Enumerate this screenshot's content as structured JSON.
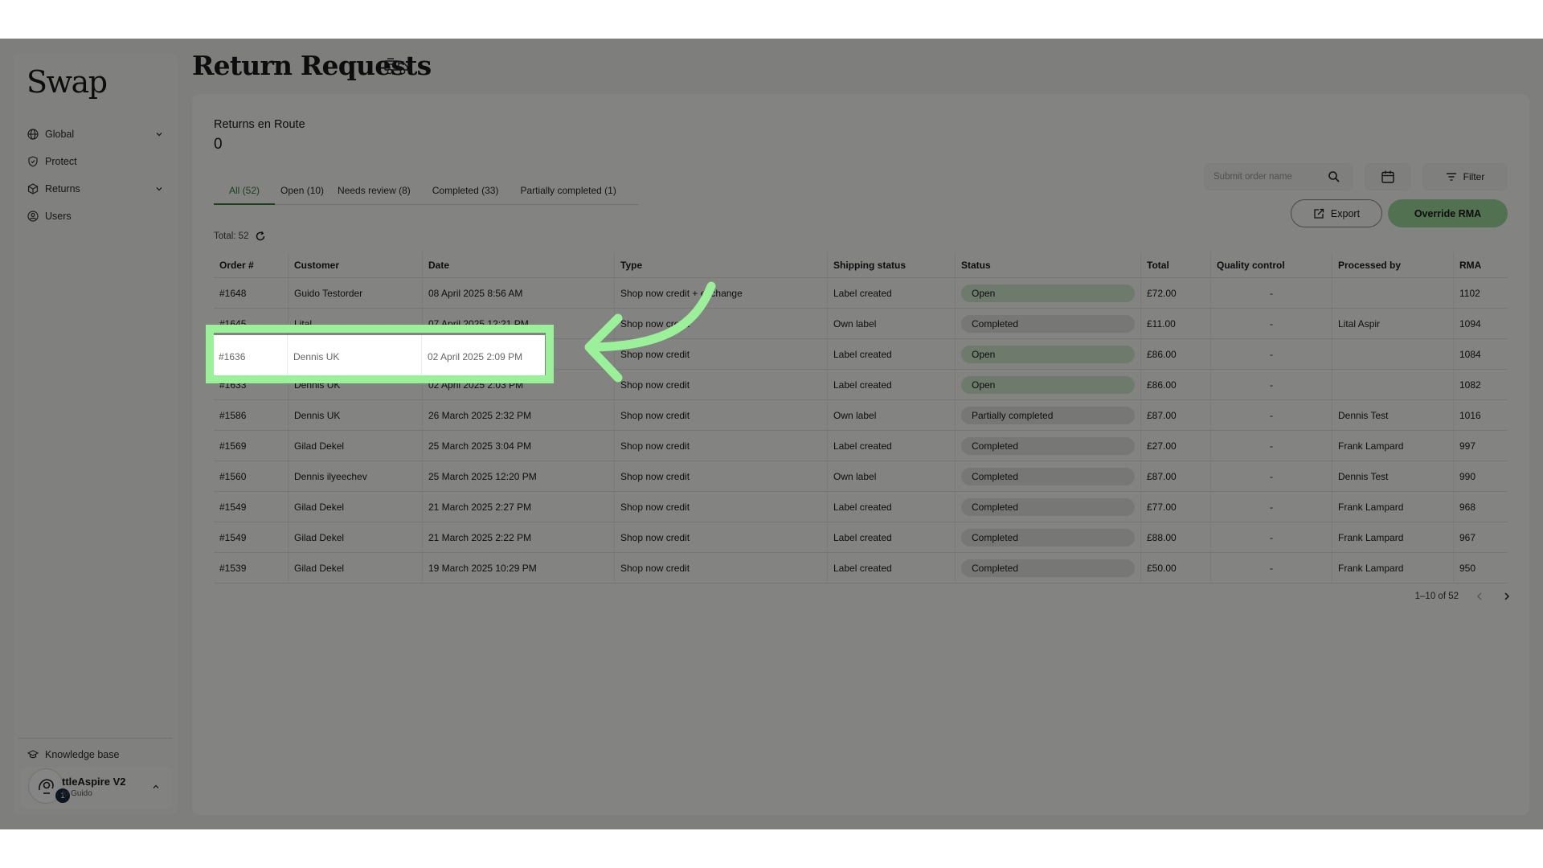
{
  "app": {
    "logo": "Swap",
    "page_title": "Return Requests"
  },
  "sidebar": {
    "items": [
      {
        "label": "Global",
        "icon": "globe-icon",
        "expandable": true
      },
      {
        "label": "Protect",
        "icon": "shield-icon",
        "expandable": false
      },
      {
        "label": "Returns",
        "icon": "package-icon",
        "expandable": true
      },
      {
        "label": "Users",
        "icon": "user-circle-icon",
        "expandable": false
      }
    ],
    "knowledge_base": "Knowledge base",
    "account": {
      "name": "ttleAspire V2",
      "sub": "to Guido",
      "badge": "1"
    }
  },
  "summary": {
    "label": "Returns en Route",
    "count": "0"
  },
  "tabs": [
    {
      "label": "All (52)",
      "active": true
    },
    {
      "label": "Open (10)",
      "active": false
    },
    {
      "label": "Needs review (8)",
      "active": false
    },
    {
      "label": "Completed (33)",
      "active": false
    },
    {
      "label": "Partially completed (1)",
      "active": false
    }
  ],
  "total_label": "Total: 52",
  "toolbar": {
    "search_placeholder": "Submit order name",
    "filter_label": "Filter",
    "export_label": "Export",
    "override_label": "Override RMA"
  },
  "table": {
    "headers": [
      "Order #",
      "Customer",
      "Date",
      "Type",
      "Shipping status",
      "Status",
      "Total",
      "Quality control",
      "Processed by",
      "RMA"
    ],
    "rows": [
      {
        "order": "#1648",
        "customer": "Guido Testorder",
        "date": "08 April 2025 8:56 AM",
        "type": "Shop now credit + exchange",
        "shipping": "Label created",
        "status": "Open",
        "total": "£72.00",
        "qc": "-",
        "processed_by": "",
        "rma": "1102"
      },
      {
        "order": "#1645",
        "customer": "Lital",
        "date": "07 April 2025 12:21 PM",
        "type": "Shop now credit",
        "shipping": "Own label",
        "status": "Completed",
        "total": "£11.00",
        "qc": "-",
        "processed_by": "Lital Aspir",
        "rma": "1094"
      },
      {
        "order": "#1636",
        "customer": "Dennis UK",
        "date": "02 April 2025 2:09 PM",
        "type": "Shop now credit",
        "shipping": "Label created",
        "status": "Open",
        "total": "£86.00",
        "qc": "-",
        "processed_by": "",
        "rma": "1084"
      },
      {
        "order": "#1633",
        "customer": "Dennis UK",
        "date": "02 April 2025 2:03 PM",
        "type": "Shop now credit",
        "shipping": "Label created",
        "status": "Open",
        "total": "£86.00",
        "qc": "-",
        "processed_by": "",
        "rma": "1082"
      },
      {
        "order": "#1586",
        "customer": "Dennis UK",
        "date": "26 March 2025 2:32 PM",
        "type": "Shop now credit",
        "shipping": "Own label",
        "status": "Partially completed",
        "total": "£87.00",
        "qc": "-",
        "processed_by": "Dennis Test",
        "rma": "1016"
      },
      {
        "order": "#1569",
        "customer": "Gilad Dekel",
        "date": "25 March 2025 3:04 PM",
        "type": "Shop now credit",
        "shipping": "Label created",
        "status": "Completed",
        "total": "£27.00",
        "qc": "-",
        "processed_by": "Frank Lampard",
        "rma": "997"
      },
      {
        "order": "#1560",
        "customer": "Dennis ilyeechev",
        "date": "25 March 2025 12:20 PM",
        "type": "Shop now credit",
        "shipping": "Own label",
        "status": "Completed",
        "total": "£87.00",
        "qc": "-",
        "processed_by": "Dennis Test",
        "rma": "990"
      },
      {
        "order": "#1549",
        "customer": "Gilad Dekel",
        "date": "21 March 2025 2:27 PM",
        "type": "Shop now credit",
        "shipping": "Label created",
        "status": "Completed",
        "total": "£77.00",
        "qc": "-",
        "processed_by": "Frank Lampard",
        "rma": "968"
      },
      {
        "order": "#1549",
        "customer": "Gilad Dekel",
        "date": "21 March 2025 2:22 PM",
        "type": "Shop now credit",
        "shipping": "Label created",
        "status": "Completed",
        "total": "£88.00",
        "qc": "-",
        "processed_by": "Frank Lampard",
        "rma": "967"
      },
      {
        "order": "#1539",
        "customer": "Gilad Dekel",
        "date": "19 March 2025 10:29 PM",
        "type": "Shop now credit",
        "shipping": "Label created",
        "status": "Completed",
        "total": "£50.00",
        "qc": "-",
        "processed_by": "Frank Lampard",
        "rma": "950"
      }
    ]
  },
  "pagination": {
    "label": "1–10 of 52"
  },
  "colors": {
    "accent_green": "#9ed89b",
    "tab_active": "#3b7a3b",
    "highlight": "#9bf09a",
    "open_pill": "#d2ead0",
    "completed_pill": "#e5e5e2"
  }
}
